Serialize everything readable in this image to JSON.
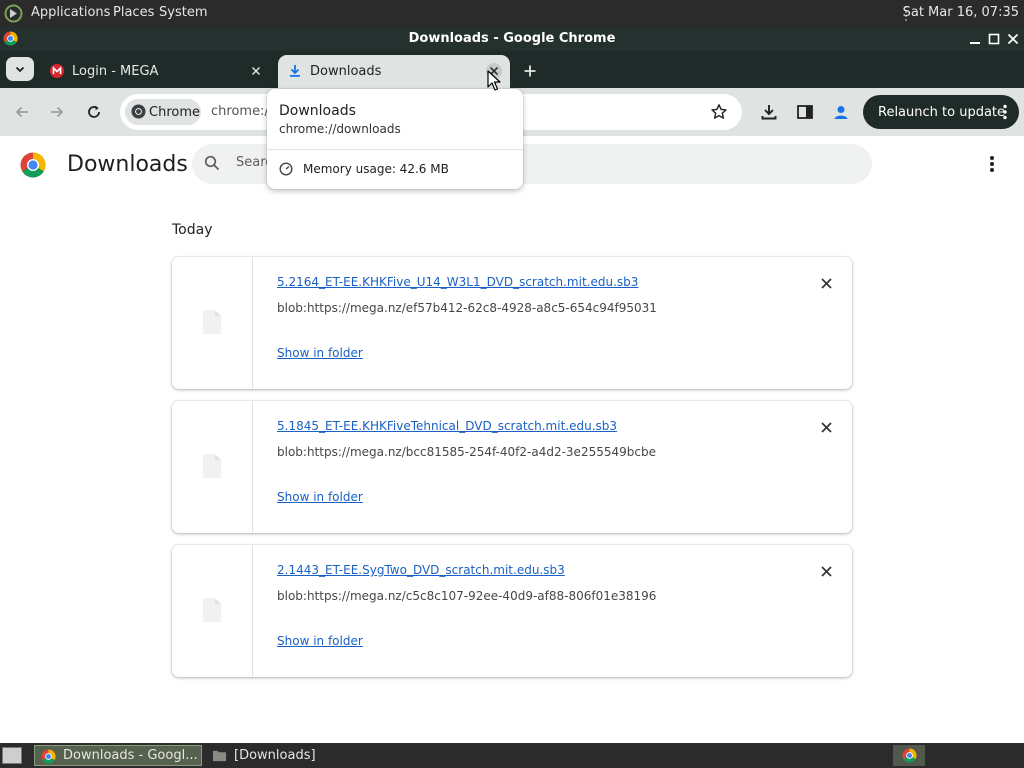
{
  "top_panel": {
    "menus": [
      "Applications",
      "Places",
      "System"
    ],
    "clock": "Sat Mar 16, 07:35"
  },
  "window": {
    "title": "Downloads - Google Chrome"
  },
  "tabs": [
    {
      "label": "Login - MEGA",
      "icon": "mega-icon",
      "active": false
    },
    {
      "label": "Downloads",
      "icon": "download-icon",
      "active": true
    }
  ],
  "toolbar": {
    "chip_label": "Chrome",
    "url": "chrome:/",
    "relaunch_label": "Relaunch to update"
  },
  "hover_card": {
    "title": "Downloads",
    "url": "chrome://downloads",
    "memory": "Memory usage: 42.6 MB"
  },
  "page": {
    "title": "Downloads",
    "search_placeholder": "Searc",
    "section": "Today"
  },
  "downloads": [
    {
      "filename": "5.2164_ET-EE.KHKFive_U14_W3L1_DVD_scratch.mit.edu.sb3",
      "url": "blob:https://mega.nz/ef57b412-62c8-4928-a8c5-654c94f95031",
      "action": "Show in folder"
    },
    {
      "filename": "5.1845_ET-EE.KHKFiveTehnical_DVD_scratch.mit.edu.sb3",
      "url": "blob:https://mega.nz/bcc81585-254f-40f2-a4d2-3e255549bcbe",
      "action": "Show in folder"
    },
    {
      "filename": "2.1443_ET-EE.SygTwo_DVD_scratch.mit.edu.sb3",
      "url": "blob:https://mega.nz/c5c8c107-92ee-40d9-af88-806f01e38196",
      "action": "Show in folder"
    }
  ],
  "taskbar": {
    "items": [
      "Downloads - Googl...",
      "[Downloads]"
    ]
  },
  "colors": {
    "link": "#1a61c4",
    "chrome_dark": "#1f2b28",
    "toolbar": "#dfe3e2"
  }
}
